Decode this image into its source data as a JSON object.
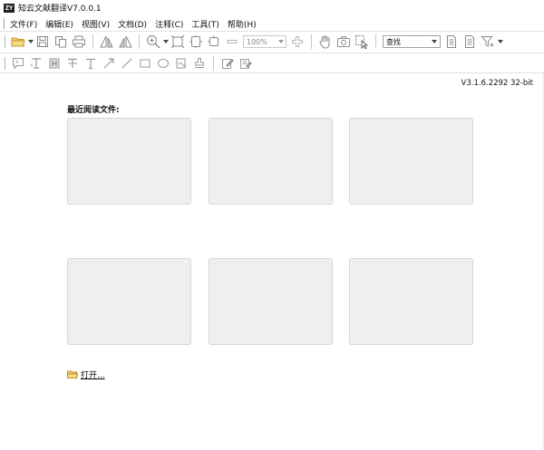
{
  "window": {
    "title": "知云文献翻译V7.0.0.1",
    "logo_text": "ZY"
  },
  "menu": {
    "items": [
      {
        "id": "file",
        "label": "文件(F)"
      },
      {
        "id": "edit",
        "label": "编辑(E)"
      },
      {
        "id": "view",
        "label": "视图(V)"
      },
      {
        "id": "document",
        "label": "文档(D)"
      },
      {
        "id": "comment",
        "label": "注释(C)"
      },
      {
        "id": "tools",
        "label": "工具(T)"
      },
      {
        "id": "help",
        "label": "帮助(H)"
      }
    ]
  },
  "toolbar": {
    "zoom_value": "100%",
    "search_label": "查找"
  },
  "main": {
    "version": "V3.1.6.2292 32-bit",
    "recent_title": "最近阅读文件:",
    "open_label": "打开..."
  },
  "colors": {
    "thumb_bg": "#efefef",
    "thumb_border": "#d6d6d6",
    "icon_gray": "#8a8a8a",
    "folder_yellow": "#e8b94a"
  }
}
